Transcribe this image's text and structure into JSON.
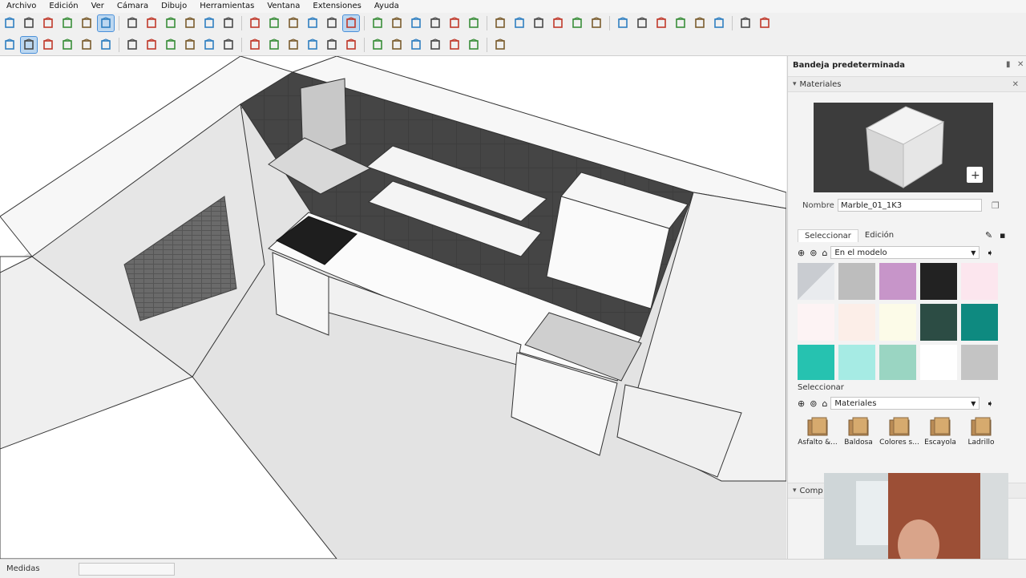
{
  "menu": [
    "Archivo",
    "Edición",
    "Ver",
    "Cámara",
    "Dibujo",
    "Herramientas",
    "Ventana",
    "Extensiones",
    "Ayuda"
  ],
  "toolbar1": [
    "iso-view-icon",
    "top-view-icon",
    "front-view-icon",
    "right-view-icon",
    "back-view-icon",
    "left-view-icon",
    "bottom-view-icon",
    "xray-icon",
    "wireframe-icon",
    "hidden-line-icon",
    "shaded-icon",
    "textured-icon",
    "monochrome-icon",
    "orbit-icon",
    "pan-icon",
    "zoom-icon",
    "zoom-window-icon",
    "zoom-extents-icon",
    "previous-view-icon",
    "position-camera-icon",
    "look-around-icon",
    "walk-icon",
    "section-plane-icon",
    "display-section-icon",
    "section-cut-icon",
    "solid-tools-icon",
    "outer-shell-icon",
    "intersect-icon",
    "union-icon",
    "subtract-icon",
    "trim-icon",
    "split-icon",
    "sandbox-icon",
    "smoove-icon",
    "stamp-icon",
    "drape-icon",
    "add-detail-icon",
    "flip-edge-icon"
  ],
  "toolbar2": [
    "search-icon",
    "select-icon",
    "eraser-icon",
    "pencil-icon",
    "arc-icon",
    "rectangle-icon",
    "push-pull-icon",
    "follow-me-icon",
    "move-icon",
    "rotate-icon",
    "scale-icon",
    "offset-icon",
    "tape-measure-icon",
    "dimension-icon",
    "protractor-icon",
    "text-icon",
    "axes-icon",
    "3d-text-icon",
    "paint-bucket-icon",
    "component-icon",
    "group-icon",
    "warehouse-icon",
    "extension-icon",
    "ocl-icon",
    "export-icon"
  ],
  "tray": {
    "title": "Bandeja predeterminada",
    "materials_header": "Materiales",
    "name_label": "Nombre",
    "name_value": "Marble_01_1K3",
    "tab_select": "Seleccionar",
    "tab_edit": "Edición",
    "dropdown_model": "En el modelo",
    "select_label": "Seleccionar",
    "dropdown_materials": "Materiales",
    "components_header": "Comp",
    "swatches": [
      "#d0d3d8",
      "#bdbdbd",
      "#c795c9",
      "#222222",
      "#fce6ee",
      "#fdf3f4",
      "#fceee8",
      "#fcfbe8",
      "#2c4c44",
      "#0e8a80",
      "#26c2b0",
      "#a6ebe4",
      "#9ad5c2",
      "#ffffff",
      "#c4c4c4"
    ],
    "folders": [
      "Asfalto &...",
      "Baldosa",
      "Colores s...",
      "Escayola",
      "Ladrillo"
    ]
  },
  "status": {
    "measure_label": "Medidas"
  }
}
